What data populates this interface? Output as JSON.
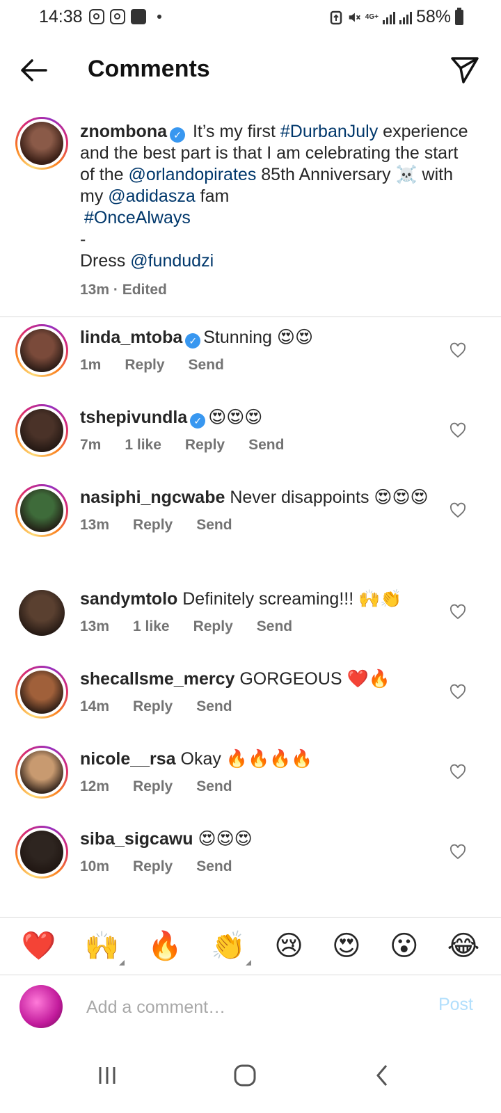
{
  "status_bar": {
    "time": "14:38",
    "network": "4G+",
    "battery": "58%"
  },
  "header": {
    "title": "Comments"
  },
  "caption": {
    "username": "znombona",
    "verified": true,
    "parts": [
      {
        "t": " It’s my first ",
        "link": false
      },
      {
        "t": "#DurbanJuly",
        "link": true
      },
      {
        "t": " experience and the best part is that I am celebrating the start of the ",
        "link": false
      },
      {
        "t": "@orlandopirates",
        "link": true
      },
      {
        "t": " 85th Anniversary ☠️ with my ",
        "link": false
      },
      {
        "t": "@adidasza",
        "link": true
      },
      {
        "t": " fam",
        "link": false
      }
    ],
    "hashtag_line": "#OnceAlways",
    "dash": "-",
    "dress_label": "Dress ",
    "dress_link": "@fundudzi",
    "time": "13m",
    "edited": "Edited"
  },
  "comments": [
    {
      "username": "linda_mtoba",
      "verified": true,
      "text": "Stunning 😍😍",
      "time": "1m",
      "likes": "",
      "reply": "Reply",
      "send": "Send",
      "ring": true,
      "avatar_color": "#7a4a3a"
    },
    {
      "username": "tshepivundla",
      "verified": true,
      "text": "😍😍😍",
      "time": "7m",
      "likes": "1 like",
      "reply": "Reply",
      "send": "Send",
      "ring": true,
      "avatar_color": "#4a3228"
    },
    {
      "username": "nasiphi_ngcwabe",
      "verified": false,
      "text": "Never disappoints 😍😍😍",
      "time": "13m",
      "likes": "",
      "reply": "Reply",
      "send": "Send",
      "ring": true,
      "avatar_color": "#3e6b3a"
    },
    {
      "username": "sandymtolo",
      "verified": false,
      "text": "Definitely screaming!!! 🙌👏",
      "time": "13m",
      "likes": "1 like",
      "reply": "Reply",
      "send": "Send",
      "ring": false,
      "avatar_color": "#5a4030"
    },
    {
      "username": "shecallsme_mercy",
      "verified": false,
      "text": "GORGEOUS ❤️🔥",
      "time": "14m",
      "likes": "",
      "reply": "Reply",
      "send": "Send",
      "ring": true,
      "avatar_color": "#a0603a"
    },
    {
      "username": "nicole__rsa",
      "verified": false,
      "text": "Okay 🔥🔥🔥🔥",
      "time": "12m",
      "likes": "",
      "reply": "Reply",
      "send": "Send",
      "ring": true,
      "avatar_color": "#c89a70"
    },
    {
      "username": "siba_sigcawu",
      "verified": false,
      "text": "😍😍😍",
      "time": "10m",
      "likes": "",
      "reply": "Reply",
      "send": "Send",
      "ring": true,
      "avatar_color": "#2e2520"
    }
  ],
  "emoji_bar": [
    {
      "emoji": "❤️",
      "name": "heart"
    },
    {
      "emoji": "🙌",
      "name": "raising-hands"
    },
    {
      "emoji": "🔥",
      "name": "fire"
    },
    {
      "emoji": "👏",
      "name": "clapping"
    },
    {
      "emoji": "😢",
      "name": "crying"
    },
    {
      "emoji": "😍",
      "name": "heart-eyes"
    },
    {
      "emoji": "😮",
      "name": "surprised"
    },
    {
      "emoji": "😂",
      "name": "tears-of-joy"
    }
  ],
  "add_comment": {
    "placeholder": "Add a comment…",
    "post_label": "Post"
  },
  "colors": {
    "link": "#00376b",
    "verified": "#3897f0",
    "meta": "#737373",
    "post_disabled": "#b2dffc"
  },
  "icons": [
    "back-arrow-icon",
    "send-icon",
    "verified-icon",
    "heart-outline-icon"
  ]
}
